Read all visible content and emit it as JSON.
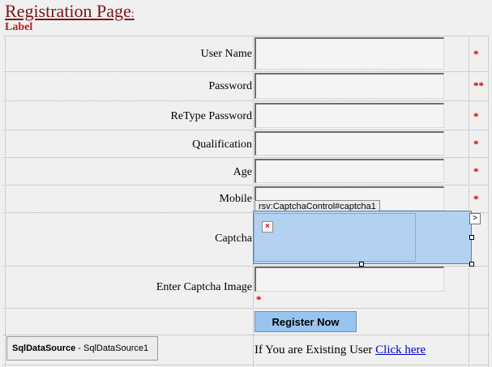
{
  "page": {
    "title": "Registration Page",
    "title_colon": ":",
    "label": "Label"
  },
  "form": {
    "fields": [
      {
        "label": "User Name",
        "value": "",
        "required": "*"
      },
      {
        "label": "Password",
        "value": "",
        "required": "**"
      },
      {
        "label": "ReType Password",
        "value": "",
        "required": "*"
      },
      {
        "label": "Qualification",
        "value": "",
        "required": "*"
      },
      {
        "label": "Age",
        "value": "",
        "required": "*"
      },
      {
        "label": "Mobile",
        "value": "",
        "required": "*"
      }
    ],
    "captcha_label": "Captcha",
    "captcha_control_tag": "rsv:CaptchaControl#captcha1",
    "captcha_smart_tag": ">",
    "broken_image_glyph": "×",
    "enter_captcha_label": "Enter Captcha Image",
    "enter_captcha_required": "*",
    "register_button": "Register Now"
  },
  "datasource": {
    "type": "SqlDataSource",
    "separator": " - ",
    "id": "SqlDataSource1"
  },
  "existing_user": {
    "text": "If You are Existing User ",
    "link": "Click here"
  },
  "colors": {
    "title": "#7a1515",
    "required": "#c00000",
    "button": "#99c4f0",
    "captcha_selection": "#b3d1f1",
    "link": "#0000cc"
  }
}
